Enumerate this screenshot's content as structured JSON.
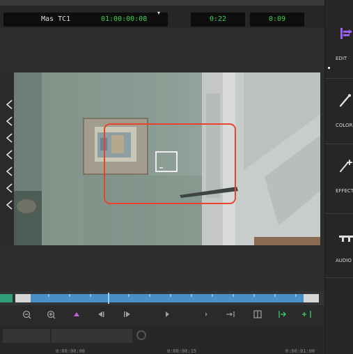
{
  "timecode_bar": {
    "master_label": "Mas TC1",
    "master_timecode": "01:00:00:08",
    "dropdown_glyph": "▾",
    "duration": "0:22",
    "remaining": "0:09"
  },
  "side_panel": {
    "items": [
      {
        "label": "EDIT",
        "icon": "edit-icon"
      },
      {
        "label": "COLOR",
        "icon": "color-icon"
      },
      {
        "label": "EFFECT",
        "icon": "effects-icon"
      },
      {
        "label": "AUDIO",
        "icon": "audio-icon"
      }
    ],
    "accent": "#9b5cf0"
  },
  "timeline": {
    "playhead_fraction": 0.3,
    "bar_color": "#4a8fc6",
    "in_color": "#2e9e7a",
    "playhead_color": "#8fd4ff"
  },
  "transport": {
    "buttons": [
      "zoom-out-icon",
      "zoom-in-icon",
      "mark-icon",
      "step-back-icon",
      "step-forward-icon",
      "play-icon",
      "shuttle-icon",
      "trim-icon",
      "split-view-icon",
      "extend-edit-icon",
      "add-edit-icon"
    ]
  },
  "lower": {
    "times": [
      "0:00:00:00",
      "0:00:00:15",
      "0:00:01:00"
    ]
  },
  "viewer": {
    "selection_box_color": "#e8432c",
    "overlay_box_color": "#e6e6e6"
  }
}
